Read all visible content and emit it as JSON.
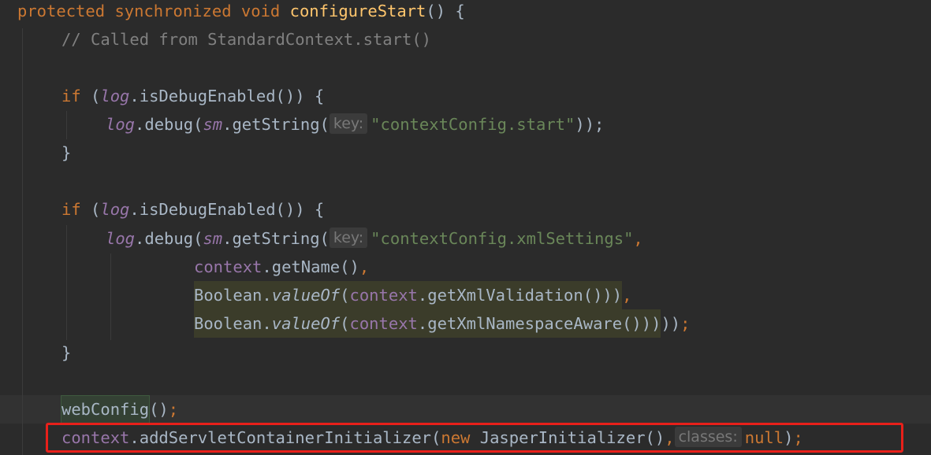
{
  "editor": {
    "lines": {
      "l1": {
        "kw1": "protected",
        "kw2": "synchronized",
        "kw3": "void",
        "fn": "configureStart",
        "rest": "() {"
      },
      "l2": {
        "comment": "// Called from StandardContext.start()"
      },
      "l4": {
        "kw": "if",
        "p1": " (",
        "fld": "log",
        "rest": ".isDebugEnabled()) {"
      },
      "l5": {
        "fld1": "log",
        "m1": ".debug(",
        "fld2": "sm",
        "m2": ".getString(",
        "hint": "key:",
        "str": "\"contextConfig.start\"",
        "rest": "));"
      },
      "l6": {
        "text": "}"
      },
      "l8": {
        "kw": "if",
        "p1": " (",
        "fld": "log",
        "rest": ".isDebugEnabled()) {"
      },
      "l9": {
        "fld1": "log",
        "m1": ".debug(",
        "fld2": "sm",
        "m2": ".getString(",
        "hint": "key:",
        "str": "\"contextConfig.xmlSettings\"",
        "comma": ","
      },
      "l10": {
        "fld": "context",
        "m": ".getName()",
        "comma": ","
      },
      "l11": {
        "cls": "Boolean.",
        "m1": "valueOf",
        "p": "(",
        "fld": "context",
        "m2": ".getXmlValidation())",
        "close": ")",
        "comma": ","
      },
      "l12": {
        "cls": "Boolean.",
        "m1": "valueOf",
        "p": "(",
        "fld": "context",
        "m2": ".getXmlNamespaceAware())",
        "close": ")",
        "rest": "));",
        "semi": ""
      },
      "l13": {
        "text": "}"
      },
      "l15": {
        "call": "webConfig",
        "rest": "();"
      },
      "l16": {
        "fld": "context",
        "m": ".addServletContainerInitializer(",
        "kw": "new",
        "cls": " JasperInitializer(),",
        "hint": "classes:",
        "nul": "null",
        "rest": ");"
      }
    }
  }
}
